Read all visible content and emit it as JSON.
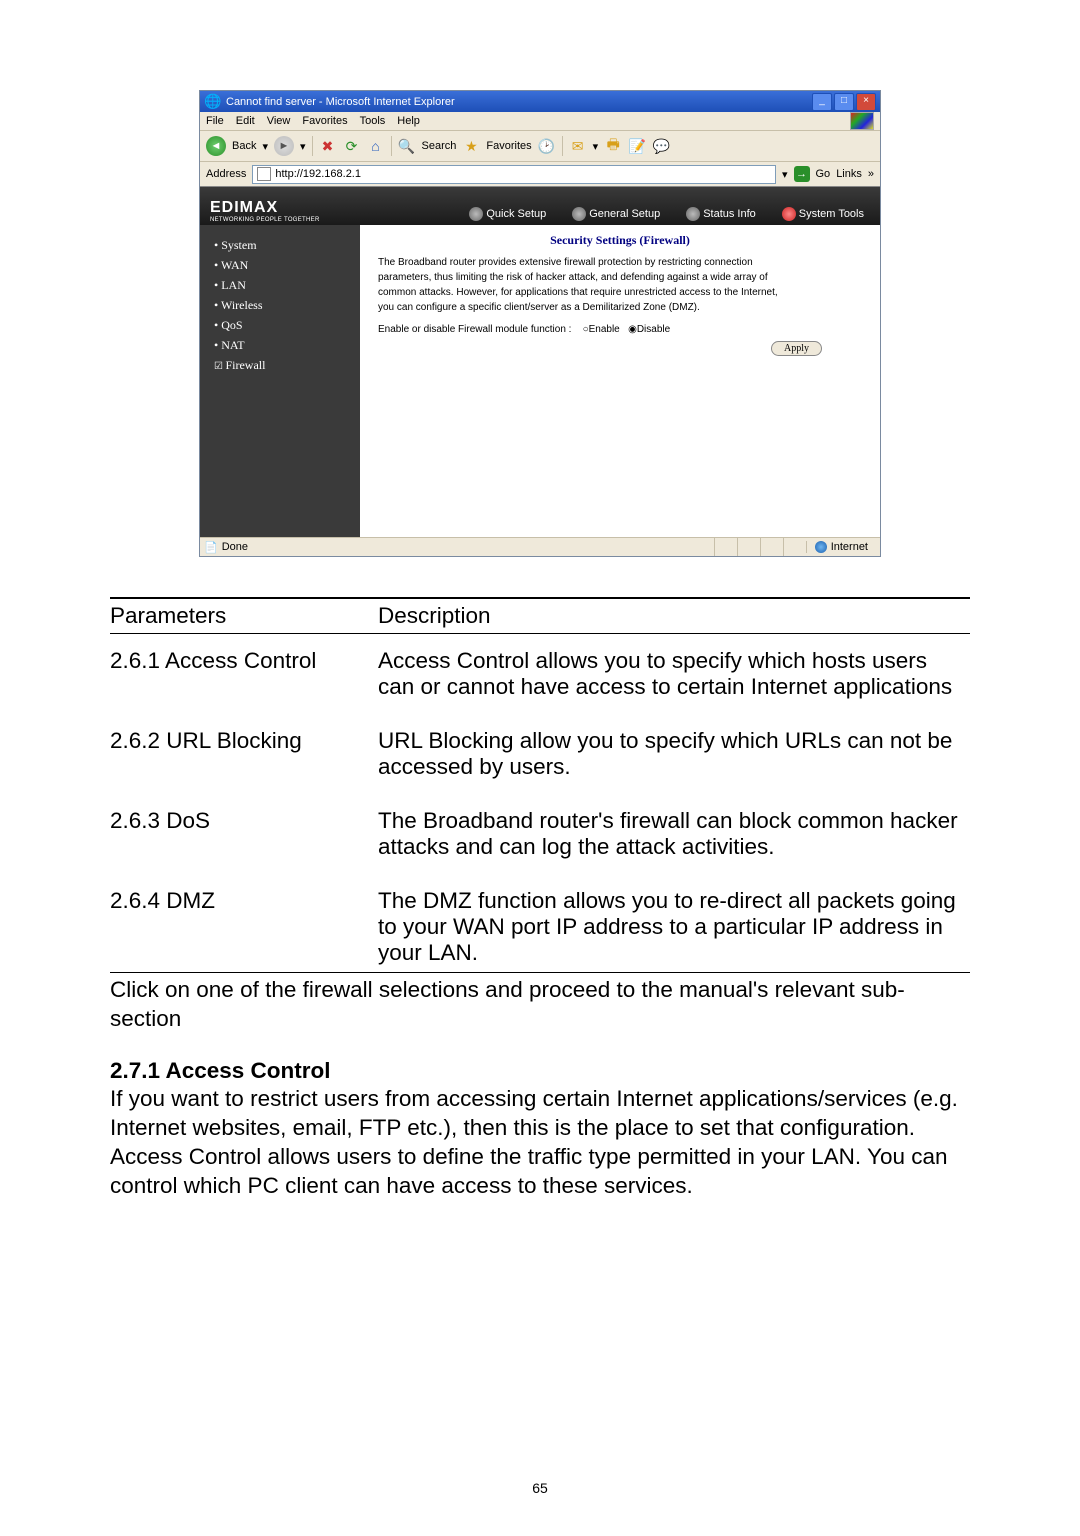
{
  "browser": {
    "title": "Cannot find server - Microsoft Internet Explorer",
    "menus": [
      "File",
      "Edit",
      "View",
      "Favorites",
      "Tools",
      "Help"
    ],
    "toolbar": {
      "back": "Back",
      "search": "Search",
      "favorites_lbl": "Favorites"
    },
    "address_label": "Address",
    "url": "http://192.168.2.1",
    "go": "Go",
    "links": "Links",
    "status_done": "Done",
    "status_zone": "Internet"
  },
  "banner": {
    "brand": "EDIMAX",
    "tagline": "NETWORKING PEOPLE TOGETHER",
    "tabs": [
      "Quick Setup",
      "General Setup",
      "Status Info",
      "System Tools"
    ],
    "active_tab": "System Tools"
  },
  "sidebar": {
    "items": [
      {
        "label": "System",
        "marker": "bullet"
      },
      {
        "label": "WAN",
        "marker": "bullet"
      },
      {
        "label": "LAN",
        "marker": "bullet"
      },
      {
        "label": "Wireless",
        "marker": "bullet"
      },
      {
        "label": "QoS",
        "marker": "bullet"
      },
      {
        "label": "NAT",
        "marker": "bullet"
      },
      {
        "label": "Firewall",
        "marker": "check"
      }
    ]
  },
  "panel": {
    "heading": "Security Settings (Firewall)",
    "p1": "The Broadband router provides extensive firewall protection by restricting connection",
    "p2": "parameters, thus limiting the risk of hacker attack, and defending against a wide array of",
    "p3": "common attacks. However, for applications that require unrestricted access to the Internet,",
    "p4": "you can configure a specific client/server as a Demilitarized Zone (DMZ).",
    "toggle_label": "Enable or disable Firewall module function :",
    "enable": "Enable",
    "disable": "Disable",
    "apply": "Apply"
  },
  "table_headers": {
    "p": "Parameters",
    "d": "Description"
  },
  "rows": [
    {
      "p": "2.6.1 Access Control",
      "d": "Access Control allows you to specify which hosts users can or cannot have access to certain Internet applications"
    },
    {
      "p": "2.6.2 URL Blocking",
      "d": "URL Blocking allow you to specify which URLs can not be accessed by users."
    },
    {
      "p": "2.6.3 DoS",
      "d": "The Broadband router's firewall can block common hacker attacks and can log the attack activities."
    },
    {
      "p": "2.6.4 DMZ",
      "d": "The DMZ function allows you to re-direct all packets going to your WAN port IP address to a particular IP address in your LAN."
    }
  ],
  "note": "Click on one of the firewall selections and proceed to the manual's relevant sub-section",
  "section": {
    "head": "2.7.1 Access Control",
    "body": "If you want to restrict users from accessing certain Internet applications/services (e.g. Internet websites, email, FTP etc.), then this is the place to set that configuration. Access Control allows users to define the traffic type permitted in your LAN. You can control which PC client can have access to these services."
  },
  "page_number": "65"
}
